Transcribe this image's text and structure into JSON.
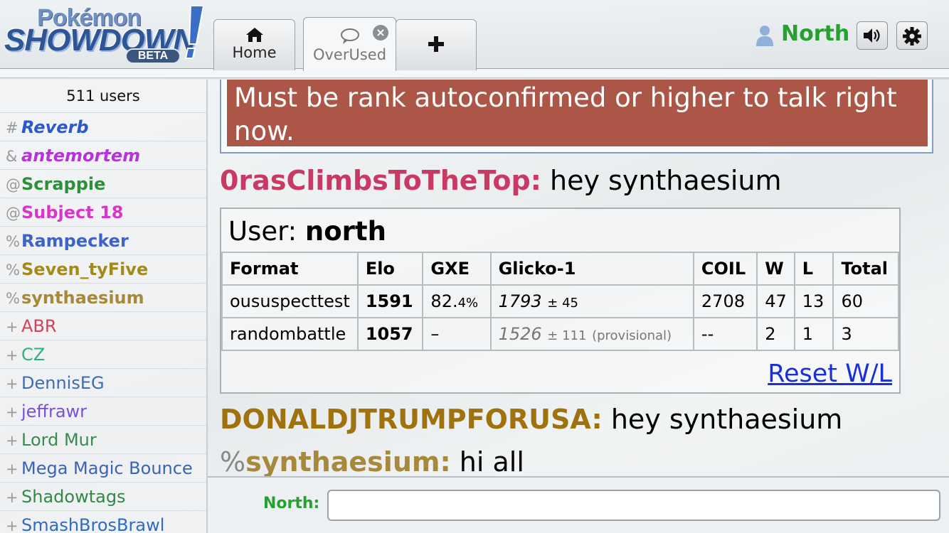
{
  "app": {
    "logo_top": "Pokémon",
    "logo_main": "SHOWDOWN",
    "logo_badge": "BETA"
  },
  "tabs": [
    {
      "label": "Home",
      "icon": "home-icon"
    },
    {
      "label": "OverUsed",
      "icon": "chat-bubble-icon",
      "active": true
    },
    {
      "label": "",
      "icon": "plus-icon"
    }
  ],
  "user": {
    "name": "North",
    "name_color": "#25a22d"
  },
  "sidebar": {
    "user_count": "511 users",
    "users": [
      {
        "rank": "#",
        "name": "Reverb",
        "color": "#2c58c9",
        "bold": true,
        "italic": true
      },
      {
        "rank": "&",
        "name": "antemortem",
        "color": "#b534d8",
        "bold": true,
        "italic": true
      },
      {
        "rank": "@",
        "name": "Scrappie",
        "color": "#2e8f3b",
        "bold": true,
        "italic": false
      },
      {
        "rank": "@",
        "name": "Subject 18",
        "color": "#d637c8",
        "bold": true,
        "italic": false
      },
      {
        "rank": "%",
        "name": "Rampecker",
        "color": "#3d63c9",
        "bold": true,
        "italic": false
      },
      {
        "rank": "%",
        "name": "Seven_tyFive",
        "color": "#a38a1a",
        "bold": true,
        "italic": false
      },
      {
        "rank": "%",
        "name": "synthaesium",
        "color": "#a6893a",
        "bold": true,
        "italic": false
      },
      {
        "rank": "+",
        "name": "ABR",
        "color": "#d6405b",
        "bold": false,
        "italic": false
      },
      {
        "rank": "+",
        "name": "CZ",
        "color": "#2fb27a",
        "bold": false,
        "italic": false
      },
      {
        "rank": "+",
        "name": "DennisEG",
        "color": "#3c6db3",
        "bold": false,
        "italic": false
      },
      {
        "rank": "+",
        "name": "jeffrawr",
        "color": "#7a4fd6",
        "bold": false,
        "italic": false
      },
      {
        "rank": "+",
        "name": "Lord Mur",
        "color": "#3a8a4f",
        "bold": false,
        "italic": false
      },
      {
        "rank": "+",
        "name": "Mega Magic Bounce",
        "color": "#3b63b8",
        "bold": false,
        "italic": false
      },
      {
        "rank": "+",
        "name": "Shadowtags",
        "color": "#2f8a45",
        "bold": false,
        "italic": false
      },
      {
        "rank": "+",
        "name": "SmashBrosBrawl",
        "color": "#2f6cc0",
        "bold": false,
        "italic": false
      }
    ]
  },
  "chat": {
    "notice": "Must be rank autoconfirmed or higher to talk right now.",
    "messages": [
      {
        "rank": "",
        "user": "0rasClimbsToTheTop:",
        "text": "hey synthaesium",
        "color": "#c83a64"
      },
      {
        "rank": "",
        "user": "DONALDJTRUMPFORUSA:",
        "text": "hey synthaesium",
        "color": "#a0720e"
      },
      {
        "rank": "%",
        "user": "synthaesium:",
        "text": "hi all",
        "color": "#a6893a"
      }
    ],
    "rank_box": {
      "prefix": "User: ",
      "username": "north",
      "headers": [
        "Format",
        "Elo",
        "GXE",
        "Glicko-1",
        "COIL",
        "W",
        "L",
        "Total"
      ],
      "rows": [
        {
          "format": "oususpecttest",
          "elo": "1591",
          "gxe": "82.",
          "gxe_dec": "4%",
          "glicko": "1793",
          "glicko_pm": "± 45",
          "provisional": "",
          "coil": "2708",
          "w": "47",
          "l": "13",
          "total": "60"
        },
        {
          "format": "randombattle",
          "elo": "1057",
          "gxe": "–",
          "gxe_dec": "",
          "glicko": "1526",
          "glicko_pm": "± 111",
          "provisional": "(provisional)",
          "coil": "--",
          "w": "2",
          "l": "1",
          "total": "3"
        }
      ],
      "reset_label": "Reset W/L"
    }
  },
  "input": {
    "label": "North:",
    "value": ""
  }
}
